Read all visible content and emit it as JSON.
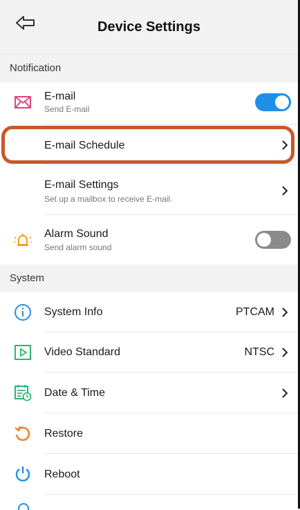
{
  "header": {
    "title": "Device Settings",
    "back_icon": "back-arrow-icon"
  },
  "sections": {
    "notification": "Notification",
    "system": "System"
  },
  "notification": {
    "email": {
      "title": "E-mail",
      "subtitle": "Send E-mail",
      "toggle_on": true,
      "icon": "envelope-icon"
    },
    "email_schedule": {
      "title": "E-mail Schedule"
    },
    "email_settings": {
      "title": "E-mail Settings",
      "subtitle": "Set up a mailbox to receive E-mail."
    },
    "alarm_sound": {
      "title": "Alarm Sound",
      "subtitle": "Send alarm sound",
      "toggle_on": false,
      "icon": "alarm-bell-icon"
    }
  },
  "system": {
    "system_info": {
      "title": "System Info",
      "value": "PTCAM",
      "icon": "info-icon"
    },
    "video_standard": {
      "title": "Video Standard",
      "value": "NTSC",
      "icon": "play-icon"
    },
    "date_time": {
      "title": "Date & Time",
      "icon": "calendar-clock-icon"
    },
    "restore": {
      "title": "Restore",
      "icon": "restore-icon"
    },
    "reboot": {
      "title": "Reboot",
      "icon": "power-icon"
    }
  },
  "colors": {
    "accent_blue": "#1e90e8",
    "toggle_off": "#8a8a8a",
    "email_icon": "#e0457b",
    "alarm_icon": "#f4a11a",
    "restore_icon": "#f27a1f",
    "video_icon": "#2bb673",
    "highlight": "#c8572b"
  }
}
